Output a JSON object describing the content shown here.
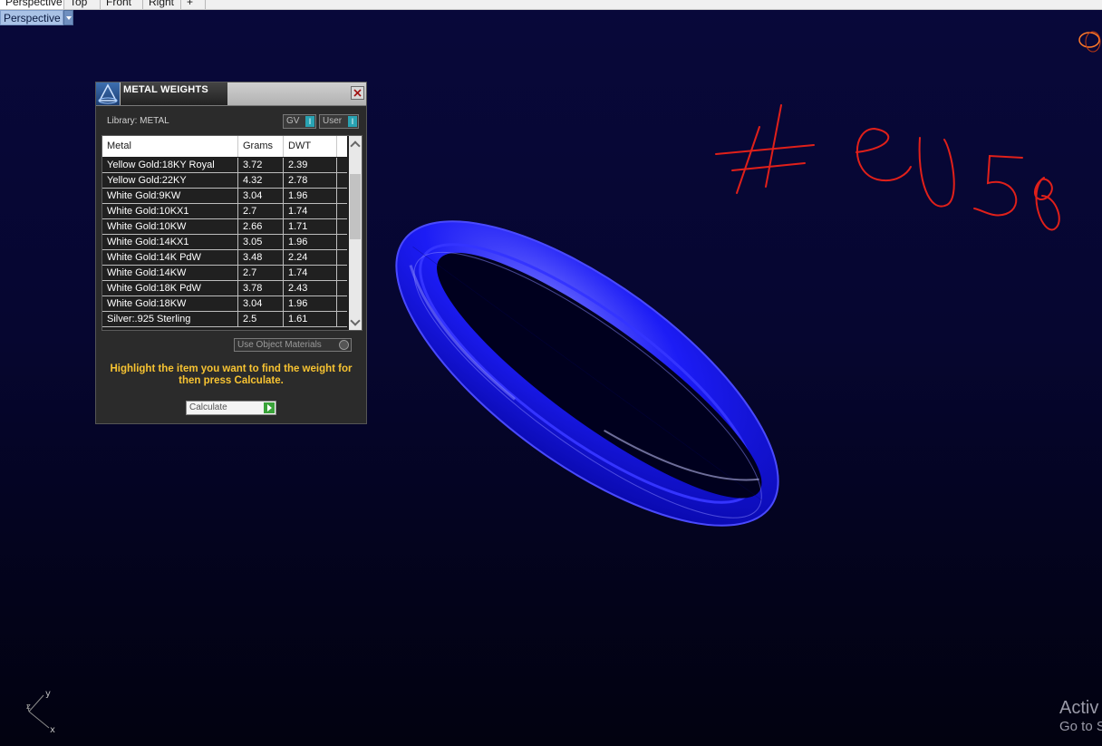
{
  "viewport_tabs": [
    "Perspective",
    "Top",
    "Front",
    "Right",
    "+"
  ],
  "active_viewport": "Perspective",
  "viewport_label": "Perspective",
  "panel": {
    "title": "METAL WEIGHTS",
    "library_label": "Library: METAL",
    "toggle_gv": "GV",
    "toggle_user": "User",
    "columns": [
      "Metal",
      "Grams",
      "DWT"
    ],
    "rows": [
      [
        "Yellow Gold:18KY Royal",
        "3.72",
        "2.39"
      ],
      [
        "Yellow Gold:22KY",
        "4.32",
        "2.78"
      ],
      [
        "White Gold:9KW",
        "3.04",
        "1.96"
      ],
      [
        "White Gold:10KX1",
        "2.7",
        "1.74"
      ],
      [
        "White Gold:10KW",
        "2.66",
        "1.71"
      ],
      [
        "White Gold:14KX1",
        "3.05",
        "1.96"
      ],
      [
        "White Gold:14K PdW",
        "3.48",
        "2.24"
      ],
      [
        "White Gold:14KW",
        "2.7",
        "1.74"
      ],
      [
        "White Gold:18K PdW",
        "3.78",
        "2.43"
      ],
      [
        "White Gold:18KW",
        "3.04",
        "1.96"
      ],
      [
        "Silver:.925 Sterling",
        "2.5",
        "1.61"
      ]
    ],
    "use_object_materials": "Use Object Materials",
    "hint": "Highlight the item you want to find the weight for then press Calculate.",
    "calculate_label": "Calculate"
  },
  "annotation_text": "#eu 58",
  "axis": {
    "x": "x",
    "y": "y",
    "z": "z"
  },
  "watermark": {
    "line1": "Activ",
    "line2": "Go to S"
  },
  "colors": {
    "background": "#060630",
    "ring": "#1818ff",
    "annotation": "#e0201a",
    "hint": "#f7c332",
    "toggle_knob": "#29a3b3"
  }
}
